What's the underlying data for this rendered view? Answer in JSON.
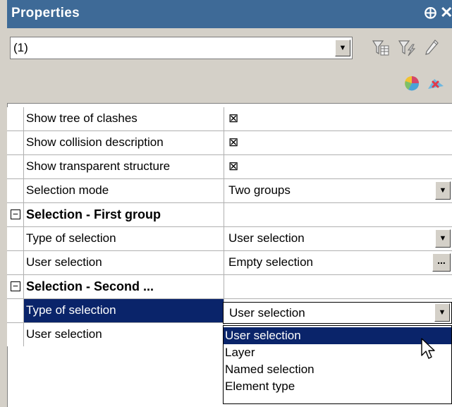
{
  "panel": {
    "title": "Properties",
    "pin_glyph": "⨁",
    "close_glyph": "✕"
  },
  "selector": {
    "value": "(1)",
    "arrow": "▼"
  },
  "toolbar": {
    "icons": [
      "filter-table-icon",
      "filter-lightning-icon",
      "pencil-icon",
      "pie-chart-icon",
      "remove-icon"
    ]
  },
  "rows": [
    {
      "name": "Show tree of clashes",
      "value": "⊠"
    },
    {
      "name": "Show collision description",
      "value": "⊠"
    },
    {
      "name": "Show transparent structure",
      "value": "⊠"
    },
    {
      "name": "Selection mode",
      "value": "Two groups"
    },
    {
      "name": "Selection - First group",
      "expander": "−"
    },
    {
      "name": "Type of selection",
      "value": "User selection"
    },
    {
      "name": "User selection",
      "value": "Empty selection",
      "button": "..."
    },
    {
      "name": "Selection - Second ...",
      "expander": "−"
    },
    {
      "name": "Type of selection",
      "value": "User selection"
    },
    {
      "name": "User selection"
    }
  ],
  "dropdown": {
    "options": [
      "User selection",
      "Layer",
      "Named selection",
      "Element type"
    ],
    "selected_index": 0
  },
  "colors": {
    "title_bar": "#3e6a97",
    "selection": "#0a246a"
  }
}
